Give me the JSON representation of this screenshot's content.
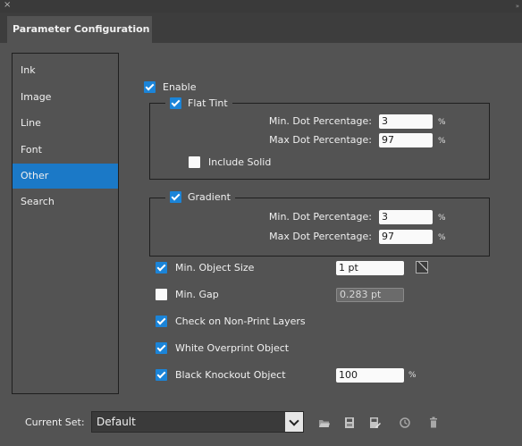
{
  "window": {
    "close_glyph": "×",
    "grip_glyph": "»"
  },
  "tab": {
    "title": "Parameter Configuration"
  },
  "sidebar": {
    "items": [
      {
        "label": "Ink",
        "active": false
      },
      {
        "label": "Image",
        "active": false
      },
      {
        "label": "Line",
        "active": false
      },
      {
        "label": "Font",
        "active": false
      },
      {
        "label": "Other",
        "active": true
      },
      {
        "label": "Search",
        "active": false
      }
    ]
  },
  "enable": {
    "label": "Enable",
    "checked": true
  },
  "flat_tint": {
    "label": "Flat Tint",
    "checked": true,
    "min_label": "Min. Dot Percentage:",
    "min_value": "3",
    "min_unit": "%",
    "max_label": "Max Dot Percentage:",
    "max_value": "97",
    "max_unit": "%",
    "include_solid_label": "Include Solid",
    "include_solid_checked": false
  },
  "gradient": {
    "label": "Gradient",
    "checked": true,
    "min_label": "Min. Dot Percentage:",
    "min_value": "3",
    "min_unit": "%",
    "max_label": "Max Dot Percentage:",
    "max_value": "97",
    "max_unit": "%"
  },
  "options": {
    "min_object_size": {
      "label": "Min. Object Size",
      "checked": true,
      "value": "1 pt",
      "icon": "none-swatch-icon"
    },
    "min_gap": {
      "label": "Min. Gap",
      "checked": false,
      "value": "0.283 pt"
    },
    "check_non_print": {
      "label": "Check on Non-Print Layers",
      "checked": true
    },
    "white_overprint": {
      "label": "White Overprint Object",
      "checked": true
    },
    "black_knockout": {
      "label": "Black Knockout Object",
      "checked": true,
      "value": "100",
      "unit": "%"
    }
  },
  "footer": {
    "current_set_label": "Current Set:",
    "current_set_value": "Default",
    "icons": [
      "open-folder-icon",
      "save-icon",
      "save-as-icon",
      "history-icon",
      "trash-icon"
    ]
  },
  "colors": {
    "accent": "#1b79c7",
    "panel": "#535353",
    "checkbox": "#1b84d8"
  }
}
